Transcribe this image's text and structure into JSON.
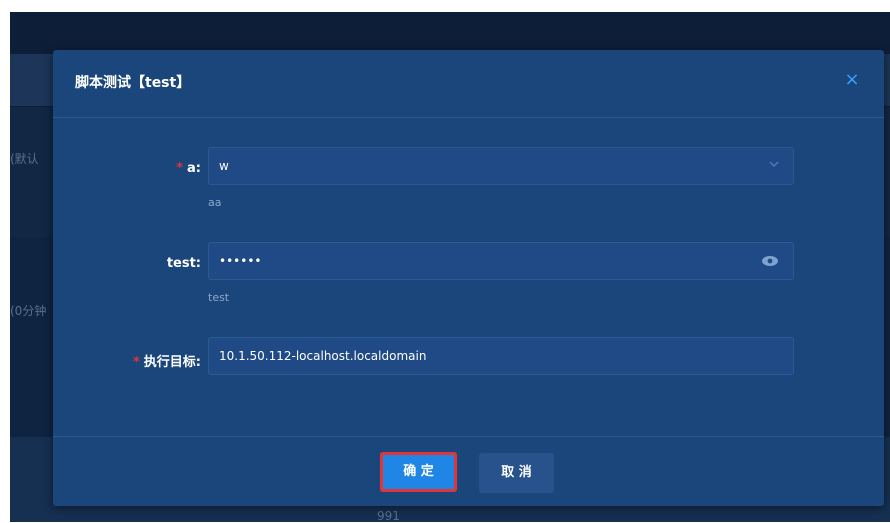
{
  "background": {
    "left_text_1": "(默认",
    "left_text_2": "(0分钟",
    "bottom_text": "991"
  },
  "modal": {
    "title": "脚本测试【test】",
    "close_icon": "×"
  },
  "form": {
    "field_a": {
      "required_mark": "*",
      "label": "a:",
      "value": "w",
      "hint": "aa"
    },
    "field_test": {
      "label": "test:",
      "value": "••••••",
      "hint": "test"
    },
    "field_target": {
      "required_mark": "*",
      "label": "执行目标:",
      "value": "10.1.50.112-localhost.localdomain"
    }
  },
  "footer": {
    "ok_label": "确 定",
    "cancel_label": "取 消"
  },
  "colors": {
    "primary": "#1f86e6",
    "modal_bg": "#1a467c",
    "required": "#e0363a",
    "highlight_border": "#e0363a"
  },
  "icons": {
    "select_icon": "chevron-down-icon",
    "password_toggle_icon": "eye-icon",
    "close_icon": "close-icon"
  }
}
